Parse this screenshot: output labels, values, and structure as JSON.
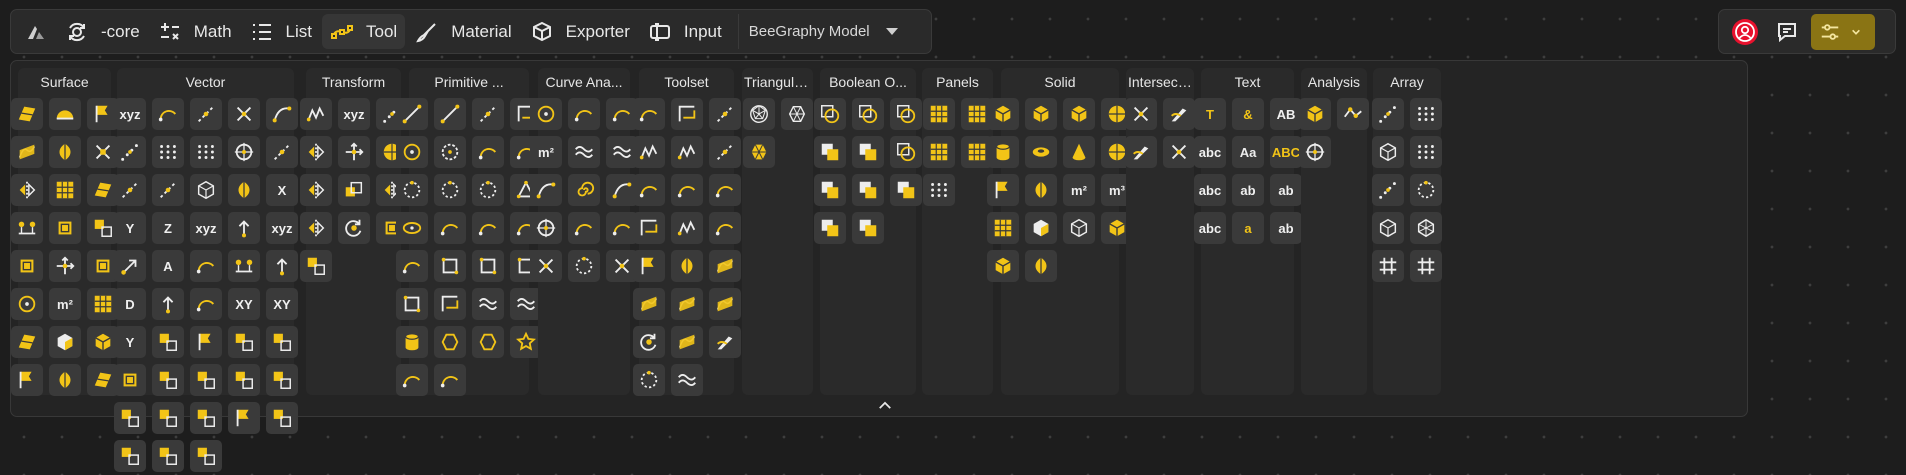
{
  "topbar": {
    "items": [
      {
        "label": "-core",
        "icon": "core-icon"
      },
      {
        "label": "Math",
        "icon": "math-icon"
      },
      {
        "label": "List",
        "icon": "list-icon"
      },
      {
        "label": "Tool",
        "icon": "tool-icon",
        "active": true
      },
      {
        "label": "Material",
        "icon": "material-icon"
      },
      {
        "label": "Exporter",
        "icon": "exporter-icon"
      },
      {
        "label": "Input",
        "icon": "input-icon"
      }
    ],
    "model_select": "BeeGraphy Model"
  },
  "colors": {
    "accent": "#f2c417",
    "background": "#1d1d1d",
    "panel": "#242424",
    "category": "#2a2a2a",
    "button": "#3a3a3a",
    "alert": "#e8112d"
  },
  "categories": [
    {
      "title": "Surface"
    },
    {
      "title": "Vector"
    },
    {
      "title": "Transform"
    },
    {
      "title": "Primitive ..."
    },
    {
      "title": "Curve Ana..."
    },
    {
      "title": "Toolset"
    },
    {
      "title": "Triangulati..."
    },
    {
      "title": "Boolean O..."
    },
    {
      "title": "Panels"
    },
    {
      "title": "Solid"
    },
    {
      "title": "Intersection"
    },
    {
      "title": "Text"
    },
    {
      "title": "Analysis"
    },
    {
      "title": "Array"
    }
  ],
  "glyphs": {
    "xyz": "xyz",
    "m2": "m²",
    "m3": "m³",
    "T": "T",
    "amp": "&",
    "abab": "AB",
    "abc123": "abc",
    "Aa": "Aa",
    "ABC": "ABC",
    "abc": "abc",
    "a": "a",
    "ab": "ab",
    "abs": "ab",
    "abx": "ab",
    "X": "X",
    "Y": "Y",
    "Z": "Z",
    "A": "A",
    "D": "D",
    "XY": "XY",
    "YZ": "Y"
  }
}
